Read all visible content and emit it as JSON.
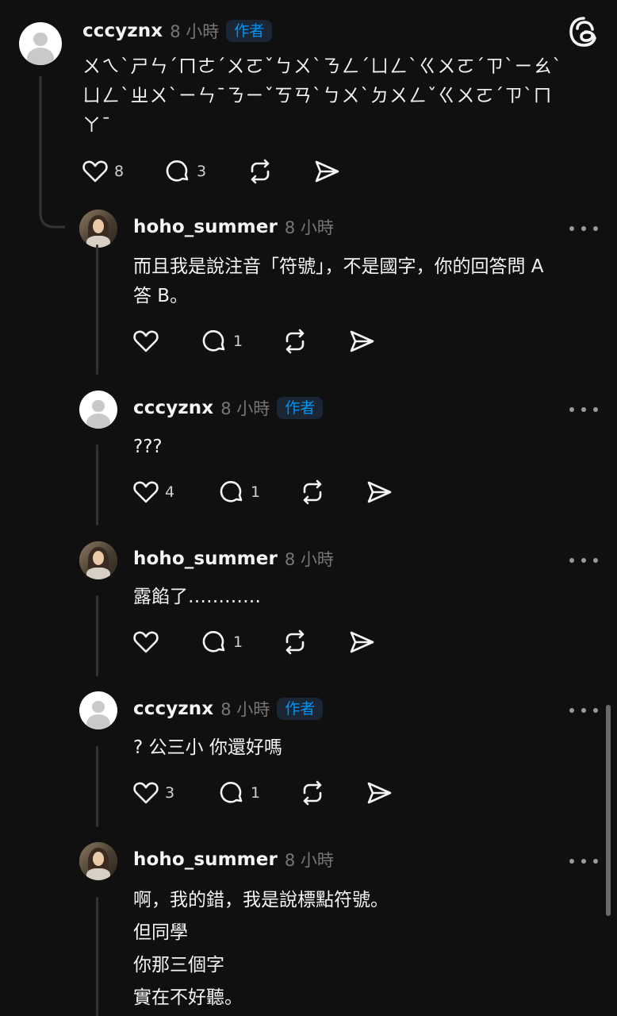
{
  "app": {
    "logo_icon": "threads-logo-icon"
  },
  "thread": [
    {
      "username": "cccyznx",
      "time": "8 小時",
      "badge": "作者",
      "avatar": "default-avatar",
      "lines": [
        "ㄨㄟˋㄕㄣˊㄇㄜˊㄨㄛˇㄅㄨˋㄋㄥˊㄩㄥˋㄍㄨㄛˊㄗˋㄧㄠˋ",
        "ㄩㄥˋㄓㄨˋㄧㄣ¯ㄋㄧˇㄎㄢˋㄅㄨˋㄉㄨㄥˇㄍㄨㄛˊㄗˋㄇ",
        "ㄚ¯"
      ],
      "likes": "8",
      "replies": "3",
      "reposts": "",
      "shares": ""
    },
    {
      "username": "hoho_summer",
      "time": "8 小時",
      "badge": "",
      "avatar": "user-photo-avatar",
      "lines": [
        "而且我是說注音「符號」，不是國字，你的回答問 A",
        "答 B。"
      ],
      "likes": "",
      "replies": "1"
    },
    {
      "username": "cccyznx",
      "time": "8 小時",
      "badge": "作者",
      "avatar": "default-avatar",
      "lines": [
        "???"
      ],
      "likes": "4",
      "replies": "1"
    },
    {
      "username": "hoho_summer",
      "time": "8 小時",
      "badge": "",
      "avatar": "user-photo-avatar",
      "lines": [
        "露餡了…………"
      ],
      "likes": "",
      "replies": "1"
    },
    {
      "username": "cccyznx",
      "time": "8 小時",
      "badge": "作者",
      "avatar": "default-avatar",
      "lines": [
        "? 公三小 你還好嗎"
      ],
      "likes": "3",
      "replies": "1"
    },
    {
      "username": "hoho_summer",
      "time": "8 小時",
      "badge": "",
      "avatar": "user-photo-avatar",
      "lines": [
        "啊，我的錯，我是說標點符號。",
        "但同學",
        "你那三個字",
        "實在不好聽。"
      ],
      "likes": "",
      "replies": ""
    }
  ],
  "icons": {
    "like": "heart-icon",
    "reply": "comment-icon",
    "repost": "repost-icon",
    "share": "send-icon",
    "more": "more-options-icon"
  }
}
